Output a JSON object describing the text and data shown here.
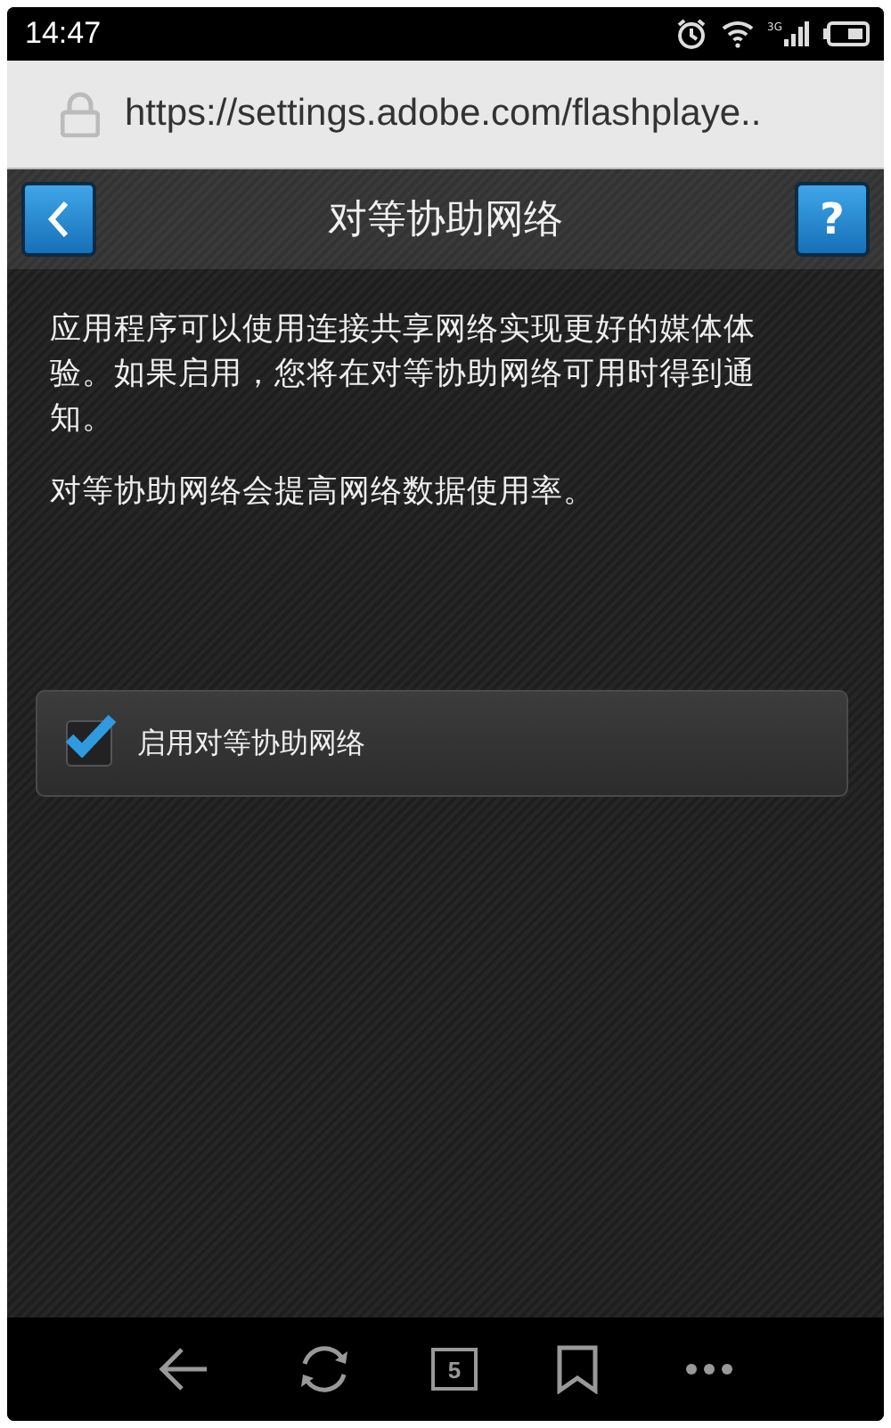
{
  "status_bar": {
    "time": "14:47",
    "network": "3G"
  },
  "address_bar": {
    "url": "https://settings.adobe.com/flashplaye.."
  },
  "header": {
    "title": "对等协助网络",
    "help": "?"
  },
  "paragraphs": [
    "应用程序可以使用连接共享网络实现更好的媒体体验。如果启用，您将在对等协助网络可用时得到通知。",
    "对等协助网络会提高网络数据使用率。"
  ],
  "option": {
    "label": "启用对等协助网络",
    "checked": true
  },
  "toolbar": {
    "tab_count": "5"
  }
}
